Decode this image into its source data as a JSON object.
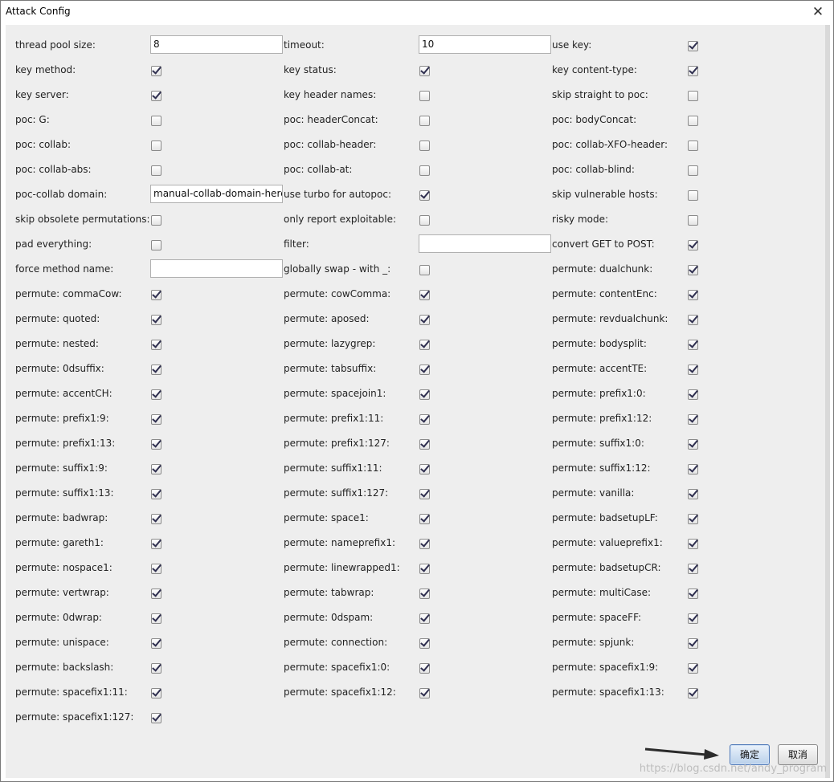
{
  "window": {
    "title": "Attack Config",
    "close_glyph": "✕"
  },
  "columns": [
    [
      {
        "label": "thread pool size:",
        "type": "text",
        "value": "8"
      },
      {
        "label": "key method:",
        "type": "checkbox",
        "checked": true
      },
      {
        "label": "key server:",
        "type": "checkbox",
        "checked": true
      },
      {
        "label": "poc: G:",
        "type": "checkbox",
        "checked": false
      },
      {
        "label": "poc: collab:",
        "type": "checkbox",
        "checked": false
      },
      {
        "label": "poc: collab-abs:",
        "type": "checkbox",
        "checked": false
      },
      {
        "label": "poc-collab domain:",
        "type": "text",
        "value": "manual-collab-domain-here"
      },
      {
        "label": "skip obsolete permutations:",
        "type": "checkbox",
        "checked": false
      },
      {
        "label": "pad everything:",
        "type": "checkbox",
        "checked": false
      },
      {
        "label": "force method name:",
        "type": "text",
        "value": ""
      },
      {
        "label": "permute: commaCow:",
        "type": "checkbox",
        "checked": true
      },
      {
        "label": "permute: quoted:",
        "type": "checkbox",
        "checked": true
      },
      {
        "label": "permute: nested:",
        "type": "checkbox",
        "checked": true
      },
      {
        "label": "permute: 0dsuffix:",
        "type": "checkbox",
        "checked": true
      },
      {
        "label": "permute: accentCH:",
        "type": "checkbox",
        "checked": true
      },
      {
        "label": "permute: prefix1:9:",
        "type": "checkbox",
        "checked": true
      },
      {
        "label": "permute: prefix1:13:",
        "type": "checkbox",
        "checked": true
      },
      {
        "label": "permute: suffix1:9:",
        "type": "checkbox",
        "checked": true
      },
      {
        "label": "permute: suffix1:13:",
        "type": "checkbox",
        "checked": true
      },
      {
        "label": "permute: badwrap:",
        "type": "checkbox",
        "checked": true
      },
      {
        "label": "permute: gareth1:",
        "type": "checkbox",
        "checked": true
      },
      {
        "label": "permute: nospace1:",
        "type": "checkbox",
        "checked": true
      },
      {
        "label": "permute: vertwrap:",
        "type": "checkbox",
        "checked": true
      },
      {
        "label": "permute: 0dwrap:",
        "type": "checkbox",
        "checked": true
      },
      {
        "label": "permute: unispace:",
        "type": "checkbox",
        "checked": true
      },
      {
        "label": "permute: backslash:",
        "type": "checkbox",
        "checked": true
      },
      {
        "label": "permute: spacefix1:11:",
        "type": "checkbox",
        "checked": true
      },
      {
        "label": "permute: spacefix1:127:",
        "type": "checkbox",
        "checked": true
      }
    ],
    [
      {
        "label": "timeout:",
        "type": "text",
        "value": "10"
      },
      {
        "label": "key status:",
        "type": "checkbox",
        "checked": true
      },
      {
        "label": "key header names:",
        "type": "checkbox",
        "checked": false
      },
      {
        "label": "poc: headerConcat:",
        "type": "checkbox",
        "checked": false
      },
      {
        "label": "poc: collab-header:",
        "type": "checkbox",
        "checked": false
      },
      {
        "label": "poc: collab-at:",
        "type": "checkbox",
        "checked": false
      },
      {
        "label": "use turbo for autopoc:",
        "type": "checkbox",
        "checked": true
      },
      {
        "label": "only report exploitable:",
        "type": "checkbox",
        "checked": false
      },
      {
        "label": "filter:",
        "type": "text",
        "value": ""
      },
      {
        "label": "globally swap - with _:",
        "type": "checkbox",
        "checked": false
      },
      {
        "label": "permute: cowComma:",
        "type": "checkbox",
        "checked": true
      },
      {
        "label": "permute: aposed:",
        "type": "checkbox",
        "checked": true
      },
      {
        "label": "permute: lazygrep:",
        "type": "checkbox",
        "checked": true
      },
      {
        "label": "permute: tabsuffix:",
        "type": "checkbox",
        "checked": true
      },
      {
        "label": "permute: spacejoin1:",
        "type": "checkbox",
        "checked": true
      },
      {
        "label": "permute: prefix1:11:",
        "type": "checkbox",
        "checked": true
      },
      {
        "label": "permute: prefix1:127:",
        "type": "checkbox",
        "checked": true
      },
      {
        "label": "permute: suffix1:11:",
        "type": "checkbox",
        "checked": true
      },
      {
        "label": "permute: suffix1:127:",
        "type": "checkbox",
        "checked": true
      },
      {
        "label": "permute: space1:",
        "type": "checkbox",
        "checked": true
      },
      {
        "label": "permute: nameprefix1:",
        "type": "checkbox",
        "checked": true
      },
      {
        "label": "permute: linewrapped1:",
        "type": "checkbox",
        "checked": true
      },
      {
        "label": "permute: tabwrap:",
        "type": "checkbox",
        "checked": true
      },
      {
        "label": "permute: 0dspam:",
        "type": "checkbox",
        "checked": true
      },
      {
        "label": "permute: connection:",
        "type": "checkbox",
        "checked": true
      },
      {
        "label": "permute: spacefix1:0:",
        "type": "checkbox",
        "checked": true
      },
      {
        "label": "permute: spacefix1:12:",
        "type": "checkbox",
        "checked": true
      }
    ],
    [
      {
        "label": "use key:",
        "type": "checkbox",
        "checked": true
      },
      {
        "label": "key content-type:",
        "type": "checkbox",
        "checked": true
      },
      {
        "label": "skip straight to poc:",
        "type": "checkbox",
        "checked": false
      },
      {
        "label": "poc: bodyConcat:",
        "type": "checkbox",
        "checked": false
      },
      {
        "label": "poc: collab-XFO-header:",
        "type": "checkbox",
        "checked": false
      },
      {
        "label": "poc: collab-blind:",
        "type": "checkbox",
        "checked": false
      },
      {
        "label": "skip vulnerable hosts:",
        "type": "checkbox",
        "checked": false
      },
      {
        "label": "risky mode:",
        "type": "checkbox",
        "checked": false
      },
      {
        "label": "convert GET to POST:",
        "type": "checkbox",
        "checked": true
      },
      {
        "label": "permute: dualchunk:",
        "type": "checkbox",
        "checked": true
      },
      {
        "label": "permute: contentEnc:",
        "type": "checkbox",
        "checked": true
      },
      {
        "label": "permute: revdualchunk:",
        "type": "checkbox",
        "checked": true
      },
      {
        "label": "permute: bodysplit:",
        "type": "checkbox",
        "checked": true
      },
      {
        "label": "permute: accentTE:",
        "type": "checkbox",
        "checked": true
      },
      {
        "label": "permute: prefix1:0:",
        "type": "checkbox",
        "checked": true
      },
      {
        "label": "permute: prefix1:12:",
        "type": "checkbox",
        "checked": true
      },
      {
        "label": "permute: suffix1:0:",
        "type": "checkbox",
        "checked": true
      },
      {
        "label": "permute: suffix1:12:",
        "type": "checkbox",
        "checked": true
      },
      {
        "label": "permute: vanilla:",
        "type": "checkbox",
        "checked": true
      },
      {
        "label": "permute: badsetupLF:",
        "type": "checkbox",
        "checked": true
      },
      {
        "label": "permute: valueprefix1:",
        "type": "checkbox",
        "checked": true
      },
      {
        "label": "permute: badsetupCR:",
        "type": "checkbox",
        "checked": true
      },
      {
        "label": "permute: multiCase:",
        "type": "checkbox",
        "checked": true
      },
      {
        "label": "permute: spaceFF:",
        "type": "checkbox",
        "checked": true
      },
      {
        "label": "permute: spjunk:",
        "type": "checkbox",
        "checked": true
      },
      {
        "label": "permute: spacefix1:9:",
        "type": "checkbox",
        "checked": true
      },
      {
        "label": "permute: spacefix1:13:",
        "type": "checkbox",
        "checked": true
      }
    ]
  ],
  "buttons": {
    "ok_label": "确定",
    "cancel_label": "取消"
  },
  "watermark": "https://blog.csdn.net/andy_program",
  "colors": {
    "panel": "#eeeeee",
    "primary_border": "#4f79b8"
  }
}
